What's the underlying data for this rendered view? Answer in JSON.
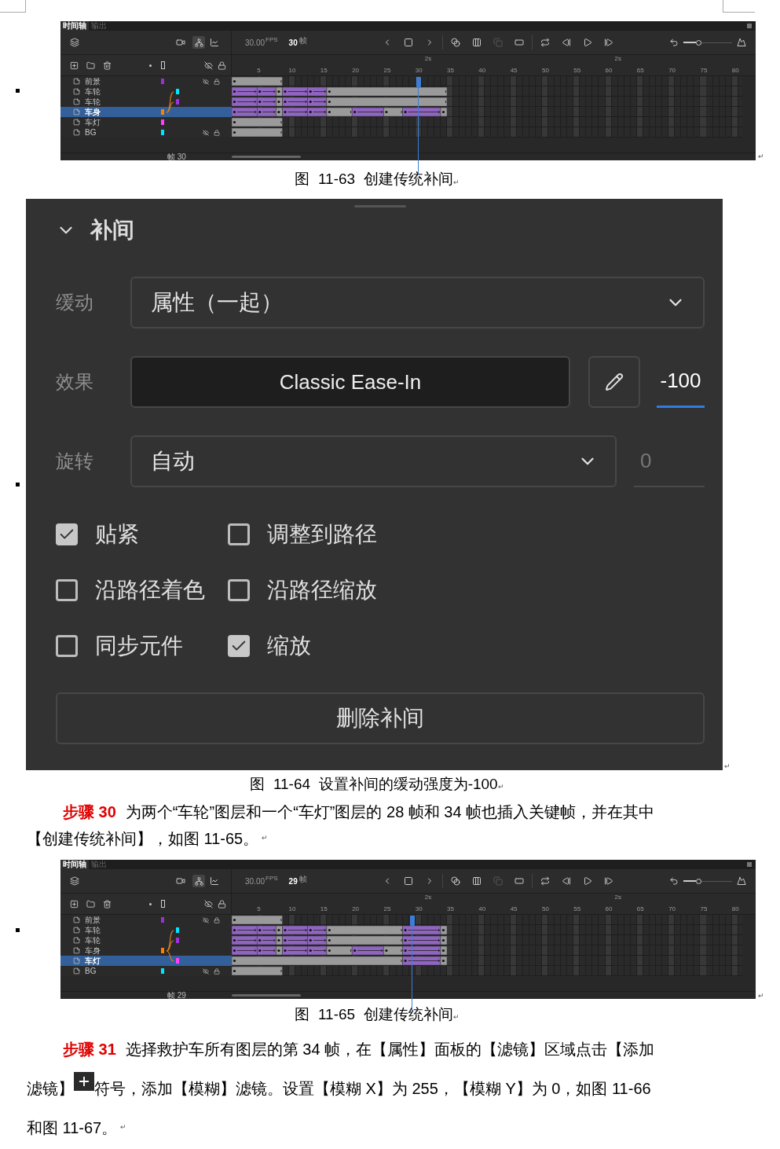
{
  "blocks": [
    {
      "kind": "timeline",
      "tabs": [
        {
          "label": "时间轴",
          "selected": true
        },
        {
          "label": "输出",
          "selected": false
        }
      ],
      "fps": "30.00",
      "fps_unit": "FPS",
      "current_frame": "30",
      "frame_unit": "帧",
      "ruler": [
        "5",
        "10",
        "15",
        "20",
        "25",
        "30",
        "35",
        "40",
        "45",
        "50",
        "55",
        "60",
        "65",
        "70",
        "75",
        "80"
      ],
      "time_marks": [
        "2s",
        "2s"
      ],
      "layers": [
        {
          "name": "前景",
          "selected": false,
          "color": "#9b30d8",
          "parented": false,
          "is_parent": false,
          "hidden": true,
          "locked": true
        },
        {
          "name": "车轮",
          "selected": false,
          "color": "#00e5ff",
          "parented": true,
          "is_parent": false,
          "hidden": false,
          "locked": false
        },
        {
          "name": "车轮",
          "selected": false,
          "color": "#a030e0",
          "parented": true,
          "is_parent": false,
          "hidden": false,
          "locked": false
        },
        {
          "name": "车身",
          "selected": true,
          "color": "#ff8000",
          "parented": false,
          "is_parent": true,
          "hidden": false,
          "locked": false
        },
        {
          "name": "车灯",
          "selected": false,
          "color": "#ff40ff",
          "parented": false,
          "is_parent": false,
          "hidden": false,
          "locked": false
        },
        {
          "name": "BG",
          "selected": false,
          "color": "#00e5ff",
          "parented": false,
          "is_parent": false,
          "hidden": true,
          "locked": true
        }
      ],
      "zoom_slider": {
        "level": 0.25
      },
      "footer": "帧 30",
      "end_mark": "↵"
    },
    {
      "kind": "caption",
      "text": "图  11-63  创建传统补间",
      "end_mark": "↵"
    },
    {
      "kind": "panel",
      "title": "补间",
      "expanded": true,
      "ease": {
        "label": "缓动",
        "value": "属性（一起）"
      },
      "effect": {
        "label": "效果",
        "value": "Classic Ease-In",
        "strength": "-100"
      },
      "rotate": {
        "label": "旋转",
        "value": "自动",
        "count": "0"
      },
      "options": [
        {
          "label": "贴紧",
          "checked": true
        },
        {
          "label": "调整到路径",
          "checked": false
        },
        {
          "label": "沿路径着色",
          "checked": false
        },
        {
          "label": "沿路径缩放",
          "checked": false
        },
        {
          "label": "同步元件",
          "checked": false
        },
        {
          "label": "缩放",
          "checked": true
        }
      ],
      "delete_button": "删除补间",
      "end_mark": "↵"
    },
    {
      "kind": "caption",
      "text": "图  11-64  设置补间的缓动强度为-100",
      "end_mark": "↵"
    },
    {
      "kind": "paragraph",
      "step": "步骤 30",
      "lines": [
        {
          "text": "为两个“车轮”图层和一个“车灯”图层的 28 帧和 34 帧也插入关键帧，并在其中",
          "icon": false
        },
        {
          "text": "【创建传统补间】，如图 11-65。",
          "icon": false,
          "end_mark": "↵"
        }
      ]
    },
    {
      "kind": "timeline",
      "tabs": [
        {
          "label": "时间轴",
          "selected": true
        },
        {
          "label": "输出",
          "selected": false
        }
      ],
      "fps": "30.00",
      "fps_unit": "FPS",
      "current_frame": "29",
      "frame_unit": "帧",
      "ruler": [
        "5",
        "10",
        "15",
        "20",
        "25",
        "30",
        "35",
        "40",
        "45",
        "50",
        "55",
        "60",
        "65",
        "70",
        "75",
        "80"
      ],
      "time_marks": [
        "2s",
        "2s"
      ],
      "layers": [
        {
          "name": "前景",
          "selected": false,
          "color": "#9b30d8",
          "parented": false,
          "is_parent": false,
          "hidden": true,
          "locked": true
        },
        {
          "name": "车轮",
          "selected": false,
          "color": "#00e5ff",
          "parented": true,
          "is_parent": false,
          "hidden": false,
          "locked": false
        },
        {
          "name": "车轮",
          "selected": false,
          "color": "#a030e0",
          "parented": true,
          "is_parent": false,
          "hidden": false,
          "locked": false
        },
        {
          "name": "车身",
          "selected": false,
          "color": "#ff8000",
          "parented": false,
          "is_parent": true,
          "hidden": false,
          "locked": false
        },
        {
          "name": "车灯",
          "selected": true,
          "color": "#ff40ff",
          "parented": true,
          "is_parent": false,
          "hidden": false,
          "locked": false
        },
        {
          "name": "BG",
          "selected": false,
          "color": "#00e5ff",
          "parented": false,
          "is_parent": false,
          "hidden": true,
          "locked": true
        }
      ],
      "zoom_slider": {
        "level": 0.25
      },
      "footer": "帧 29",
      "end_mark": "↵"
    },
    {
      "kind": "caption",
      "text": "图  11-65  创建传统补间",
      "end_mark": "↵"
    },
    {
      "kind": "paragraph",
      "step": "步骤 31",
      "lines": [
        {
          "text": "选择救护车所有图层的第 34 帧，在【属性】面板的【滤镜】区域点击【添加",
          "icon": false
        },
        {
          "text": "滤镜】",
          "icon": true,
          "text_after": "符号，添加【模糊】滤镜。设置【模糊 X】为 255，【模糊 Y】为 0，如图 11-66"
        },
        {
          "text": "和图 11-67。",
          "icon": false,
          "end_mark": "↵"
        }
      ]
    }
  ]
}
